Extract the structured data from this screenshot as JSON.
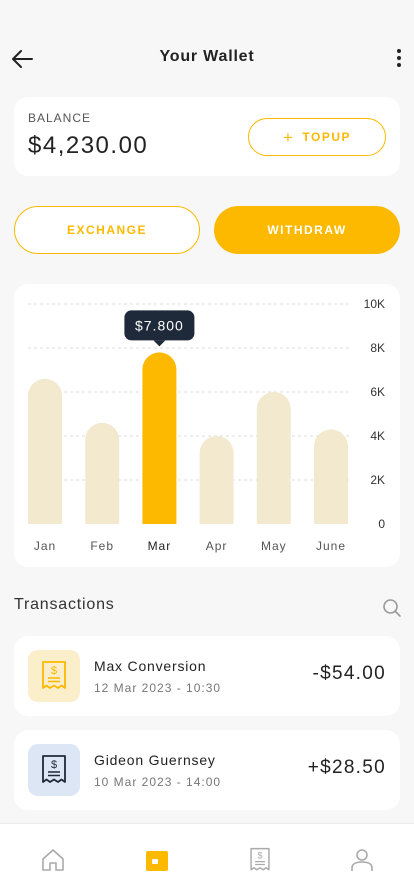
{
  "header": {
    "title": "Your Wallet",
    "back_icon": "arrow-left-icon",
    "more_icon": "more-vertical-icon"
  },
  "balance": {
    "label": "BALANCE",
    "value": "$4,230.00",
    "topup_label": "TOPUP",
    "topup_icon": "plus-icon"
  },
  "actions": {
    "exchange_label": "EXCHANGE",
    "withdraw_label": "WITHDRAW"
  },
  "colors": {
    "accent": "#fcb900",
    "bar_muted": "#f2e9cf",
    "tooltip_bg": "#1e2a3a",
    "card_bg": "#ffffff",
    "page_bg": "#f7f7f7",
    "receipt_yellow_bg": "#fbeecb",
    "receipt_blue_bg": "#dde6f5",
    "receipt_blue_icon": "#1e2a3a"
  },
  "chart_data": {
    "type": "bar",
    "categories": [
      "Jan",
      "Feb",
      "Mar",
      "Apr",
      "May",
      "June"
    ],
    "values": [
      6600,
      4600,
      7800,
      4000,
      6000,
      4300
    ],
    "highlight_index": 2,
    "tooltip": "$7.800",
    "yticks": [
      "10K",
      "8K",
      "6K",
      "4K",
      "2K",
      "0"
    ],
    "ylim": [
      0,
      10000
    ],
    "grid": true
  },
  "transactions": {
    "title": "Transactions",
    "search_icon": "search-icon",
    "items": [
      {
        "name": "Max Conversion",
        "date": "12 Mar 2023 - 10:30",
        "amount": "-$54.00",
        "icon": "receipt-icon"
      },
      {
        "name": "Gideon Guernsey",
        "date": "10 Mar 2023 - 14:00",
        "amount": "+$28.50",
        "icon": "receipt-icon"
      }
    ]
  },
  "nav": {
    "items": [
      "home-icon",
      "wallet-icon",
      "receipt-icon",
      "user-icon"
    ],
    "active_index": 1
  }
}
